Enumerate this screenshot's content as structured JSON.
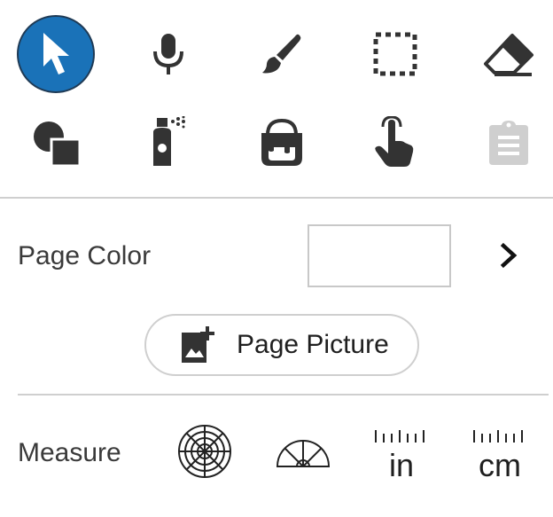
{
  "tools": [
    {
      "name": "select",
      "icon": "arrow-pointer-icon",
      "selected": true
    },
    {
      "name": "voice",
      "icon": "microphone-icon"
    },
    {
      "name": "brush",
      "icon": "paintbrush-icon"
    },
    {
      "name": "selection",
      "icon": "dashed-selection-icon"
    },
    {
      "name": "eraser",
      "icon": "eraser-icon"
    },
    {
      "name": "shapes",
      "icon": "shapes-icon"
    },
    {
      "name": "spray",
      "icon": "spray-can-icon"
    },
    {
      "name": "fill",
      "icon": "paint-bucket-icon"
    },
    {
      "name": "touch",
      "icon": "hand-pointer-icon"
    },
    {
      "name": "clipboard",
      "icon": "clipboard-icon",
      "disabled": true
    }
  ],
  "page_color": {
    "label": "Page Color",
    "value": "#ffffff",
    "chevron_icon": "chevron-right-icon"
  },
  "page_picture": {
    "label": "Page Picture",
    "icon": "add-photo-icon"
  },
  "measure": {
    "label": "Measure",
    "tools": [
      {
        "name": "polar-grid",
        "icon": "polar-grid-icon"
      },
      {
        "name": "protractor",
        "icon": "protractor-icon"
      },
      {
        "name": "inch-ruler",
        "icon": "inch-ruler-icon",
        "unit": "in"
      },
      {
        "name": "cm-ruler",
        "icon": "cm-ruler-icon",
        "unit": "cm"
      }
    ]
  },
  "colors": {
    "accent": "#1a72b8",
    "icon": "#333333",
    "disabled": "#cfcfcf",
    "divider": "#cfcfcf"
  }
}
